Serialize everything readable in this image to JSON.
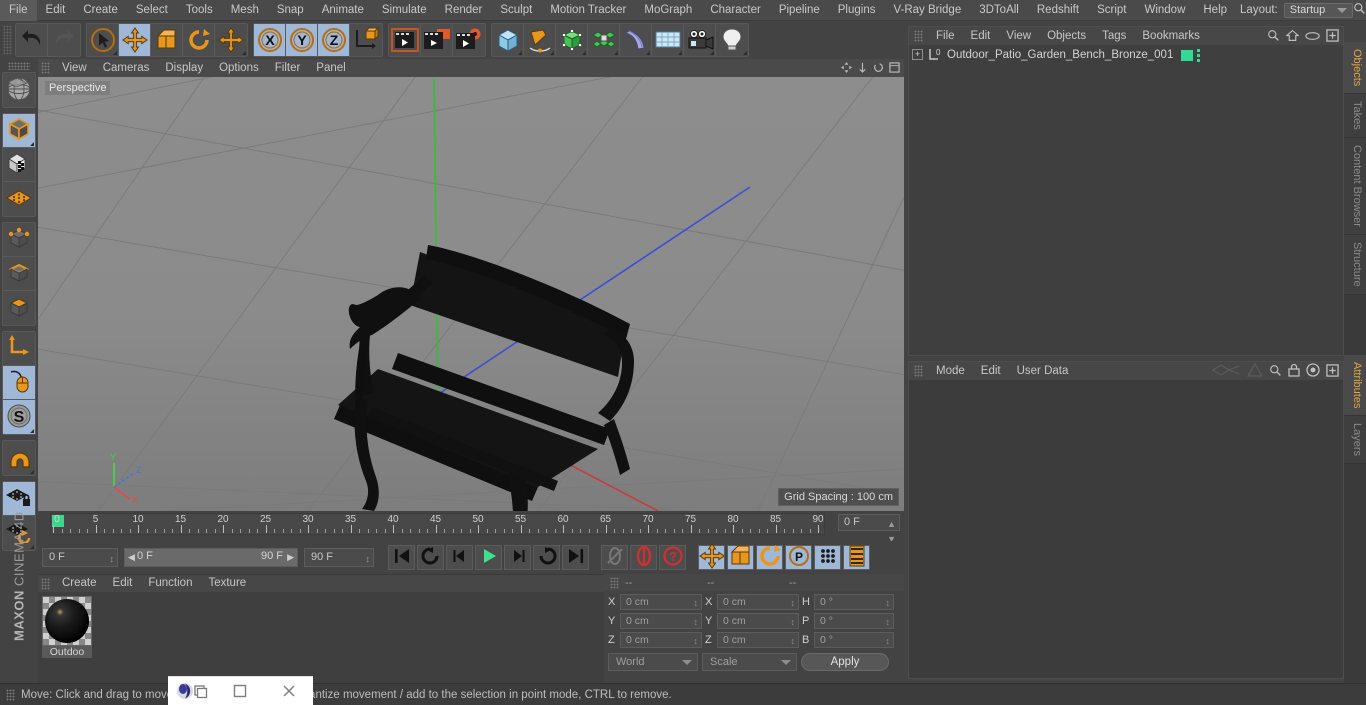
{
  "app": {
    "brand_line1": "MAXON",
    "brand_line2": "CINEMA 4D"
  },
  "menubar": {
    "items": [
      "File",
      "Edit",
      "Create",
      "Select",
      "Tools",
      "Mesh",
      "Snap",
      "Animate",
      "Simulate",
      "Render",
      "Sculpt",
      "Motion Tracker",
      "MoGraph",
      "Character",
      "Pipeline",
      "Plugins",
      "V-Ray Bridge",
      "3DToAll",
      "Redshift",
      "Script",
      "Window",
      "Help"
    ],
    "layout_label": "Layout:",
    "layout_value": "Startup",
    "search_icon": "search-icon"
  },
  "toolbar": {
    "groups": [
      {
        "name": "undo-redo",
        "buttons": [
          {
            "name": "undo-button",
            "icon": "undo-icon",
            "selected": false,
            "corner": false
          },
          {
            "name": "redo-button",
            "icon": "redo-icon",
            "selected": false,
            "corner": false
          }
        ]
      },
      {
        "name": "transform-tools",
        "buttons": [
          {
            "name": "live-selection-tool",
            "icon": "cursor-circle-icon",
            "selected": false,
            "corner": true
          },
          {
            "name": "move-tool",
            "icon": "move-arrows-icon",
            "selected": true,
            "corner": false
          },
          {
            "name": "scale-tool",
            "icon": "scale-box-icon",
            "selected": false,
            "corner": false
          },
          {
            "name": "rotate-tool",
            "icon": "rotate-arc-icon",
            "selected": false,
            "corner": false
          },
          {
            "name": "transform-tool",
            "icon": "move-arrows-icon",
            "selected": false,
            "corner": true
          }
        ]
      },
      {
        "name": "axis-locks",
        "buttons": [
          {
            "name": "lock-x-axis-button",
            "icon": "x-axis-icon",
            "selected": true,
            "corner": false
          },
          {
            "name": "lock-y-axis-button",
            "icon": "y-axis-icon",
            "selected": true,
            "corner": false
          },
          {
            "name": "lock-z-axis-button",
            "icon": "z-axis-icon",
            "selected": true,
            "corner": false
          },
          {
            "name": "world-object-coordinates-button",
            "icon": "world-axis-cube-icon",
            "selected": false,
            "corner": false
          }
        ]
      },
      {
        "name": "render-tools",
        "buttons": [
          {
            "name": "render-view-button",
            "icon": "render-view-icon",
            "selected": false,
            "corner": false
          },
          {
            "name": "render-to-picture-viewer-button",
            "icon": "render-picture-icon",
            "selected": false,
            "corner": false
          },
          {
            "name": "render-settings-button",
            "icon": "render-settings-icon",
            "selected": false,
            "corner": false
          }
        ]
      },
      {
        "name": "object-creation",
        "buttons": [
          {
            "name": "add-cube-button",
            "icon": "cube-icon",
            "selected": false,
            "corner": true
          },
          {
            "name": "add-spline-button",
            "icon": "pen-spline-icon",
            "selected": false,
            "corner": true
          },
          {
            "name": "add-nurbs-button",
            "icon": "green-cube-nurbs-icon",
            "selected": false,
            "corner": true
          },
          {
            "name": "add-array-button",
            "icon": "cluster-icon",
            "selected": false,
            "corner": true
          },
          {
            "name": "add-deformer-button",
            "icon": "bend-deformer-icon",
            "selected": false,
            "corner": true
          },
          {
            "name": "add-scene-environment-button",
            "icon": "floor-grid-icon",
            "selected": false,
            "corner": true
          },
          {
            "name": "add-camera-button",
            "icon": "camera-icon",
            "selected": false,
            "corner": true
          },
          {
            "name": "add-light-button",
            "icon": "light-bulb-icon",
            "selected": false,
            "corner": true
          }
        ]
      }
    ]
  },
  "left_toolbar": {
    "buttons": [
      {
        "name": "undo-view-button",
        "icon": "globe-wire-icon",
        "selected": false,
        "corner": false
      },
      {
        "name": "model-mode-button",
        "icon": "model-cube-icon",
        "selected": true,
        "corner": true
      },
      {
        "name": "texture-mode-button",
        "icon": "texture-checker-cube-icon",
        "selected": false,
        "corner": false
      },
      {
        "name": "workplane-mode-button",
        "icon": "workplane-grid-icon",
        "selected": false,
        "corner": false
      },
      {
        "name": "points-mode-button",
        "icon": "points-cube-icon",
        "selected": false,
        "corner": false
      },
      {
        "name": "edges-mode-button",
        "icon": "edges-cube-icon",
        "selected": false,
        "corner": false
      },
      {
        "name": "polygons-mode-button",
        "icon": "polygons-cube-icon",
        "selected": false,
        "corner": false
      },
      {
        "name": "object-axis-button",
        "icon": "axis-l-icon",
        "selected": false,
        "corner": false
      },
      {
        "name": "enable-snapping-button",
        "icon": "mouse-icon",
        "selected": true,
        "corner": false
      },
      {
        "name": "soft-selection-button",
        "icon": "s-circle-icon",
        "selected": true,
        "corner": true
      },
      {
        "name": "magnet-tool-button",
        "icon": "magnet-icon",
        "selected": false,
        "corner": true
      },
      {
        "name": "lock-workplane-button",
        "icon": "grid-lock-icon",
        "selected": true,
        "corner": false
      },
      {
        "name": "workplane-align-button",
        "icon": "grid-rotate-icon",
        "selected": false,
        "corner": true
      }
    ]
  },
  "viewport": {
    "menu": [
      "View",
      "Cameras",
      "Display",
      "Options",
      "Filter",
      "Panel"
    ],
    "perspective_label": "Perspective",
    "grid_spacing_label": "Grid Spacing : 100 cm",
    "axis_gizmo": {
      "x": "X",
      "y": "Y",
      "z": "Z",
      "x_color": "#e04b4b",
      "y_color": "#4bd14b",
      "z_color": "#4b6fe0"
    },
    "model": {
      "name": "garden-bench-model",
      "color": "#121212"
    },
    "floor_color": "#8a8a8a",
    "axis_line_colors": {
      "x": "#c83c3c",
      "y": "#2fc22f",
      "z": "#3b4fd4"
    }
  },
  "timeline": {
    "ticks": [
      "0",
      "5",
      "10",
      "15",
      "20",
      "25",
      "30",
      "35",
      "40",
      "45",
      "50",
      "55",
      "60",
      "65",
      "70",
      "75",
      "80",
      "85",
      "90"
    ],
    "current_frame_field": "0 F",
    "start_field": "0 F",
    "range_start": "0 F",
    "range_end": "90 F",
    "end_field": "90 F",
    "transport_buttons": [
      {
        "name": "go-to-start-button",
        "icon": "skip-start-icon",
        "selected": false
      },
      {
        "name": "play-backwards-loop-button",
        "icon": "loop-back-icon",
        "selected": false
      },
      {
        "name": "previous-frame-button",
        "icon": "step-back-icon",
        "selected": false
      },
      {
        "name": "play-button",
        "icon": "play-icon",
        "selected": false
      },
      {
        "name": "next-frame-button",
        "icon": "step-forward-icon",
        "selected": false
      },
      {
        "name": "play-forwards-loop-button",
        "icon": "loop-forward-icon",
        "selected": false
      },
      {
        "name": "go-to-end-button",
        "icon": "skip-end-icon",
        "selected": false
      }
    ],
    "record_buttons": [
      {
        "name": "autokeying-button",
        "icon": "no-key-icon",
        "selected": false
      },
      {
        "name": "record-active-objects-button",
        "icon": "record-red-icon",
        "selected": false
      },
      {
        "name": "auto-keyframing-button",
        "icon": "question-red-icon",
        "selected": false
      }
    ],
    "key_toggle_buttons": [
      {
        "name": "key-position-button",
        "icon": "move-arrows-icon",
        "selected": true
      },
      {
        "name": "key-scale-button",
        "icon": "scale-box-icon",
        "selected": true
      },
      {
        "name": "key-rotation-button",
        "icon": "rotate-arc-icon",
        "selected": true
      },
      {
        "name": "key-parameter-button",
        "icon": "p-circle-icon",
        "selected": true
      },
      {
        "name": "key-point-level-animation-button",
        "icon": "pla-dots-icon",
        "selected": true
      },
      {
        "name": "keyframe-selection-button",
        "icon": "keyframe-strip-icon",
        "selected": true
      }
    ]
  },
  "material_manager": {
    "menu": [
      "Create",
      "Edit",
      "Function",
      "Texture"
    ],
    "materials": [
      {
        "name": "Outdoo",
        "swatch_color": "#0a0a0a"
      }
    ]
  },
  "coordinates": {
    "header_dashes": [
      "--",
      "--",
      "--"
    ],
    "rows": [
      {
        "pos_label": "X",
        "pos_value": "0 cm",
        "size_label": "X",
        "size_value": "0 cm",
        "rot_label": "H",
        "rot_value": "0 °"
      },
      {
        "pos_label": "Y",
        "pos_value": "0 cm",
        "size_label": "Y",
        "size_value": "0 cm",
        "rot_label": "P",
        "rot_value": "0 °"
      },
      {
        "pos_label": "Z",
        "pos_value": "0 cm",
        "size_label": "Z",
        "size_value": "0 cm",
        "rot_label": "B",
        "rot_value": "0 °"
      }
    ],
    "coord_system": "World",
    "transform_mode": "Scale",
    "apply_label": "Apply"
  },
  "objects_panel": {
    "menu": [
      "File",
      "Edit",
      "View",
      "Objects",
      "Tags",
      "Bookmarks"
    ],
    "icons": [
      "search-icon",
      "home-icon",
      "eye-icon",
      "plus-box-icon"
    ],
    "tree": [
      {
        "name": "Outdoor_Patio_Garden_Bench_Bronze_001",
        "layer_badge": "0",
        "green_dot_color": "#2fdc93"
      }
    ]
  },
  "attributes_panel": {
    "menu": [
      "Mode",
      "Edit",
      "User Data"
    ],
    "icons": [
      "spline-icon",
      "triangle-icon",
      "search-icon",
      "lock-icon",
      "target-icon",
      "plus-box-icon"
    ]
  },
  "right_tabs_top": [
    {
      "label": "Objects",
      "active": true
    },
    {
      "label": "Takes",
      "active": false
    },
    {
      "label": "Content Browser",
      "active": false
    },
    {
      "label": "Structure",
      "active": false
    }
  ],
  "right_tabs_bottom": [
    {
      "label": "Attributes",
      "active": true
    },
    {
      "label": "Layers",
      "active": false
    }
  ],
  "statusbar": {
    "text": "Move: Click and drag to move the selection, SHIFT to quantize movement / add to the selection in point mode, CTRL to remove."
  },
  "window_overlay": {
    "app_icon": "cinema4d-icon",
    "restore_icon": "restore-icon",
    "maximize_icon": "maximize-icon",
    "close_icon": "close-icon"
  }
}
